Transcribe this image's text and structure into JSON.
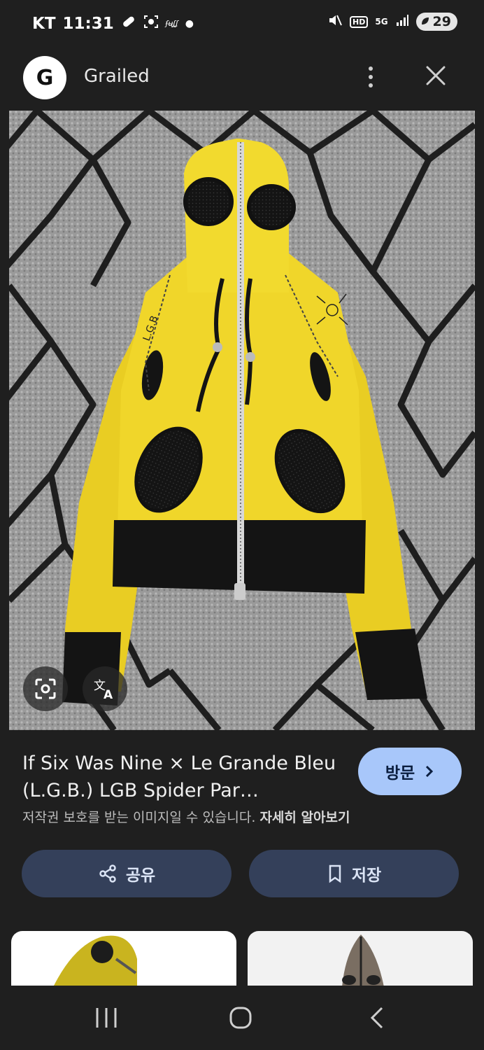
{
  "status": {
    "carrier": "KT",
    "time": "11:31",
    "network": "5G",
    "hd": "HD",
    "battery": "29"
  },
  "header": {
    "logo_letter": "G",
    "site_name": "Grailed"
  },
  "image": {
    "chest_text": "L.G.B"
  },
  "info": {
    "title": "If Six Was Nine × Le Grande Bleu (L.G.B.) LGB Spider Par…",
    "copyright_text": "저작권 보호를 받는 이미지일 수 있습니다.",
    "learn_more": "자세히 알아보기",
    "visit_label": "방문"
  },
  "actions": {
    "share_label": "공유",
    "save_label": "저장"
  },
  "colors": {
    "background": "#1f1f1f",
    "visit_button": "#a8c7fa",
    "action_button": "#34405a",
    "hoodie_yellow": "#f0d62a"
  }
}
